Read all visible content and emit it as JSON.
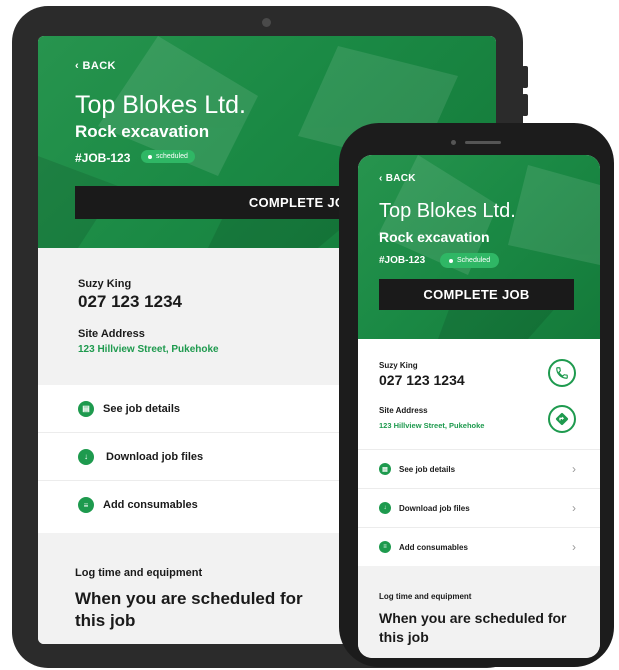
{
  "job": {
    "back_label": "‹ BACK",
    "company": "Top Blokes Ltd.",
    "job_type": "Rock excavation",
    "job_number": "#JOB-123",
    "status_tablet": "scheduled",
    "status_phone": "Scheduled",
    "complete_label": "COMPLETE JOB"
  },
  "contact": {
    "name": "Suzy King",
    "phone": "027 123 1234",
    "address_label": "Site Address",
    "address": "123 Hillview Street, Pukehoke"
  },
  "menu": {
    "items": [
      {
        "label": "See job details",
        "icon": "document-icon"
      },
      {
        "label": "Download job files",
        "icon": "download-file-icon"
      },
      {
        "label": "Add consumables",
        "icon": "list-icon"
      }
    ]
  },
  "log": {
    "label": "Log time and equipment",
    "message": "When you are scheduled for this job"
  },
  "colors": {
    "brand_green": "#1e9a4e",
    "badge_green": "#2fb765",
    "dark": "#1a1a1a",
    "panel_grey": "#f2f2f2"
  }
}
